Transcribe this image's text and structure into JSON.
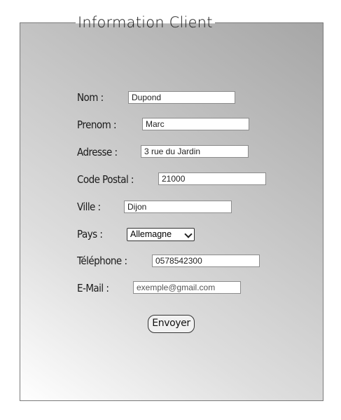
{
  "form": {
    "legend": "Information Client",
    "fields": {
      "nom": {
        "label": "Nom :",
        "value": "Dupond"
      },
      "prenom": {
        "label": "Prenom :",
        "value": "Marc"
      },
      "adresse": {
        "label": "Adresse :",
        "value": "3 rue du Jardin"
      },
      "code_postal": {
        "label": "Code Postal :",
        "value": "21000"
      },
      "ville": {
        "label": "Ville :",
        "value": "Dijon"
      },
      "pays": {
        "label": "Pays :",
        "selected": "Allemagne"
      },
      "telephone": {
        "label": "Téléphone :",
        "value": "0578542300"
      },
      "email": {
        "label": "E-Mail :",
        "placeholder": "exemple@gmail.com"
      }
    },
    "submit_label": "Envoyer"
  }
}
